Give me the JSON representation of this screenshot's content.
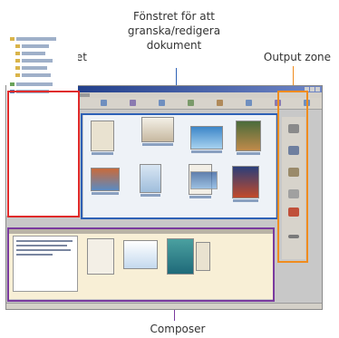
{
  "labels": {
    "viewer_lines": [
      "Fönstret för att",
      "granska/redigera",
      "dokument"
    ],
    "folder": "Mappfönstret",
    "output": "Output zone",
    "composer": "Composer"
  },
  "colors": {
    "folder_box": "#e02a2a",
    "viewer_box": "#2e61b6",
    "output_box": "#f08c1e",
    "composer_box": "#7a3a9e"
  },
  "icons": [
    "folder-icon",
    "document-thumbnail",
    "printer-icon",
    "monitor-icon",
    "disk-icon"
  ]
}
